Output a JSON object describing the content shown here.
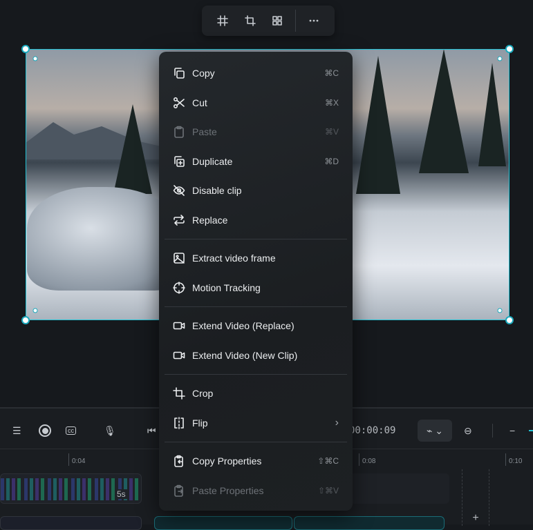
{
  "toolbar": {
    "icons": [
      "grid-icon",
      "crop-icon",
      "apps-icon",
      "more-icon"
    ]
  },
  "menu": {
    "items": [
      {
        "label": "Copy",
        "shortcut": "⌘C",
        "icon": "copy-icon",
        "enabled": true
      },
      {
        "label": "Cut",
        "shortcut": "⌘X",
        "icon": "scissors-icon",
        "enabled": true
      },
      {
        "label": "Paste",
        "shortcut": "⌘V",
        "icon": "clipboard-icon",
        "enabled": false
      },
      {
        "label": "Duplicate",
        "shortcut": "⌘D",
        "icon": "duplicate-icon",
        "enabled": true
      },
      {
        "label": "Disable clip",
        "shortcut": "",
        "icon": "eye-off-icon",
        "enabled": true
      },
      {
        "label": "Replace",
        "shortcut": "",
        "icon": "replace-icon",
        "enabled": true
      },
      {
        "label": "Extract video frame",
        "shortcut": "",
        "icon": "image-icon",
        "enabled": true
      },
      {
        "label": "Motion Tracking",
        "shortcut": "",
        "icon": "crosshair-icon",
        "enabled": true
      },
      {
        "label": "Extend Video (Replace)",
        "shortcut": "",
        "icon": "video-icon",
        "enabled": true
      },
      {
        "label": "Extend Video (New Clip)",
        "shortcut": "",
        "icon": "video-icon",
        "enabled": true
      },
      {
        "label": "Crop",
        "shortcut": "",
        "icon": "crop-icon",
        "enabled": true
      },
      {
        "label": "Flip",
        "shortcut": "",
        "icon": "flip-icon",
        "enabled": true,
        "submenu": true
      },
      {
        "label": "Copy Properties",
        "shortcut": "⇧⌘C",
        "icon": "copy-properties-icon",
        "enabled": true
      },
      {
        "label": "Paste Properties",
        "shortcut": "⇧⌘V",
        "icon": "paste-properties-icon",
        "enabled": false
      }
    ]
  },
  "timeline": {
    "timecode": "00:00:09",
    "ruler": [
      "0:04",
      "0:08",
      "0:10"
    ],
    "clip_duration": "5s",
    "add_label": "+"
  },
  "colors": {
    "selection": "#22c3d6",
    "accent": "#1aa9bd"
  }
}
